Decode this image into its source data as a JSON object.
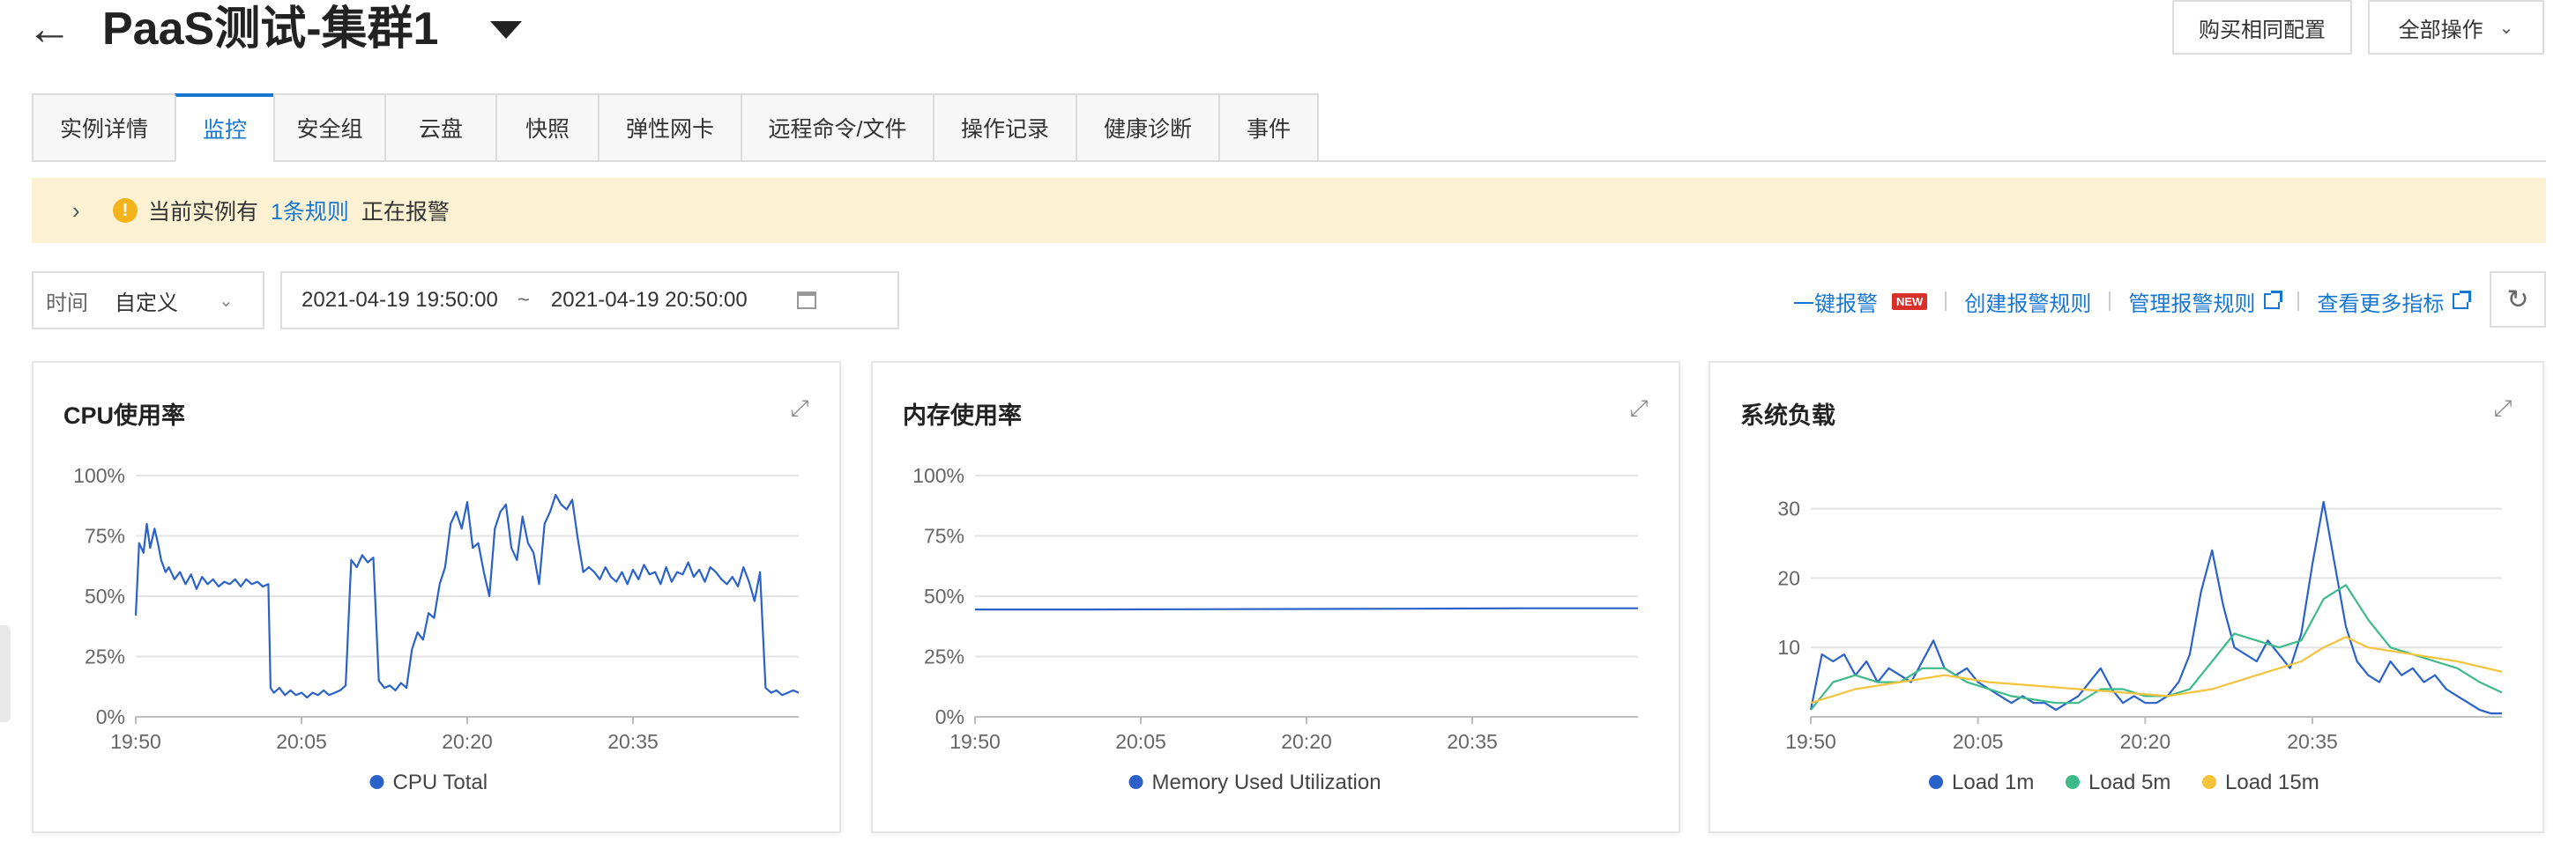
{
  "header": {
    "title": "PaaS测试-集群1",
    "buy_same_config": "购买相同配置",
    "all_operations": "全部操作"
  },
  "tabs": [
    {
      "label": "实例详情",
      "active": false
    },
    {
      "label": "监控",
      "active": true
    },
    {
      "label": "安全组",
      "active": false
    },
    {
      "label": "云盘",
      "active": false
    },
    {
      "label": "快照",
      "active": false
    },
    {
      "label": "弹性网卡",
      "active": false
    },
    {
      "label": "远程命令/文件",
      "active": false
    },
    {
      "label": "操作记录",
      "active": false
    },
    {
      "label": "健康诊断",
      "active": false
    },
    {
      "label": "事件",
      "active": false
    }
  ],
  "alert": {
    "prefix": "当前实例有",
    "link": "1条规则",
    "suffix": "正在报警"
  },
  "filter": {
    "time_label": "时间",
    "time_mode": "自定义",
    "start": "2021-04-19 19:50:00",
    "separator": "~",
    "end": "2021-04-19 20:50:00"
  },
  "actions": {
    "one_click_alarm": "一键报警",
    "new_badge": "NEW",
    "create_rule": "创建报警规则",
    "manage_rules": "管理报警规则",
    "more_metrics": "查看更多指标"
  },
  "colors": {
    "accent": "#1677d2",
    "load1": "#2a62c9",
    "load5": "#3dba8a",
    "load15": "#f4c23b",
    "alert_bg": "#fcf2d3"
  },
  "cards": [
    {
      "title": "CPU使用率",
      "chart_data": {
        "type": "line",
        "x_ticks": [
          "19:50",
          "20:05",
          "20:20",
          "20:35"
        ],
        "y_ticks": [
          "0%",
          "25%",
          "50%",
          "75%",
          "100%"
        ],
        "ylim": [
          0,
          100
        ],
        "xlim": [
          0,
          60
        ],
        "series": [
          {
            "name": "CPU Total",
            "color": "#2a62c9",
            "x": [
              0,
              0.3,
              0.7,
              1,
              1.3,
              1.7,
              2,
              2.3,
              2.7,
              3,
              3.5,
              4,
              4.5,
              5,
              5.5,
              6,
              6.5,
              7,
              7.5,
              8,
              8.5,
              9,
              9.5,
              10,
              10.5,
              11,
              11.5,
              12,
              12.2,
              12.5,
              13,
              13.5,
              14,
              14.5,
              15,
              15.5,
              16,
              16.5,
              17,
              17.5,
              18,
              18.5,
              19,
              19.5,
              20,
              20.5,
              21,
              21.5,
              22,
              22.5,
              23,
              23.5,
              24,
              24.5,
              25,
              25.5,
              26,
              26.5,
              27,
              27.5,
              28,
              28.5,
              29,
              29.5,
              30,
              30.5,
              31,
              31.5,
              32,
              32.5,
              33,
              33.5,
              34,
              34.5,
              35,
              35.5,
              36,
              36.5,
              37,
              37.5,
              38,
              38.5,
              39,
              39.5,
              40,
              40.5,
              41,
              41.5,
              42,
              42.5,
              43,
              43.5,
              44,
              44.5,
              45,
              45.5,
              46,
              46.5,
              47,
              47.5,
              48,
              48.5,
              49,
              49.5,
              50,
              50.5,
              51,
              51.5,
              52,
              52.5,
              53,
              53.5,
              54,
              54.5,
              55,
              55.5,
              56,
              56.5,
              57,
              57.5,
              58,
              58.5,
              59,
              59.5,
              60
            ],
            "values": [
              42,
              72,
              68,
              80,
              70,
              78,
              72,
              65,
              60,
              62,
              57,
              60,
              55,
              59,
              53,
              58,
              55,
              57,
              54,
              56,
              55,
              57,
              54,
              57,
              55,
              56,
              54,
              55,
              12,
              10,
              12,
              9,
              11,
              9,
              10,
              8,
              10,
              9,
              11,
              9,
              10,
              11,
              13,
              65,
              62,
              67,
              64,
              66,
              15,
              12,
              13,
              11,
              14,
              12,
              28,
              35,
              32,
              43,
              41,
              55,
              62,
              80,
              85,
              78,
              89,
              70,
              72,
              60,
              50,
              78,
              85,
              88,
              70,
              65,
              83,
              72,
              68,
              55,
              80,
              85,
              92,
              88,
              86,
              90,
              74,
              60,
              62,
              60,
              57,
              62,
              58,
              56,
              60,
              55,
              61,
              57,
              63,
              59,
              60,
              55,
              62,
              56,
              60,
              59,
              64,
              58,
              61,
              56,
              62,
              60,
              57,
              55,
              58,
              54,
              62,
              56,
              48,
              60,
              12,
              10,
              11,
              9,
              10,
              11,
              10,
              11,
              12,
              10,
              11
            ],
            "x_unit": "minutes since 19:50"
          }
        ]
      }
    },
    {
      "title": "内存使用率",
      "chart_data": {
        "type": "line",
        "x_ticks": [
          "19:50",
          "20:05",
          "20:20",
          "20:35"
        ],
        "y_ticks": [
          "0%",
          "25%",
          "50%",
          "75%",
          "100%"
        ],
        "ylim": [
          0,
          100
        ],
        "xlim": [
          0,
          60
        ],
        "series": [
          {
            "name": "Memory Used Utilization",
            "color": "#2a62c9",
            "x": [
              0,
              10,
              20,
              30,
              40,
              50,
              60
            ],
            "values": [
              44.5,
              44.5,
              44.6,
              44.7,
              44.8,
              45,
              45
            ]
          }
        ]
      }
    },
    {
      "title": "系统负载",
      "chart_data": {
        "type": "line",
        "x_ticks": [
          "19:50",
          "20:05",
          "20:20",
          "20:35"
        ],
        "y_ticks": [
          "10",
          "20",
          "30"
        ],
        "ylim": [
          0,
          33
        ],
        "xlim": [
          0,
          62
        ],
        "series": [
          {
            "name": "Load 1m",
            "color": "#2a62c9",
            "x": [
              0,
              1,
              2,
              3,
              4,
              5,
              6,
              7,
              8,
              9,
              10,
              11,
              12,
              13,
              14,
              15,
              16,
              17,
              18,
              19,
              20,
              21,
              22,
              23,
              24,
              25,
              26,
              27,
              28,
              29,
              30,
              31,
              32,
              33,
              34,
              35,
              36,
              37,
              38,
              39,
              40,
              41,
              42,
              43,
              44,
              45,
              46,
              47,
              48,
              49,
              50,
              51,
              52,
              53,
              54,
              55,
              56,
              57,
              58,
              59,
              60,
              61,
              62
            ],
            "values": [
              1,
              9,
              8,
              9,
              6,
              8,
              5,
              7,
              6,
              5,
              8,
              11,
              7,
              6,
              7,
              5,
              4,
              3,
              2,
              3,
              2,
              2,
              1,
              2,
              3,
              5,
              7,
              4,
              2,
              3,
              2,
              2,
              3,
              5,
              9,
              18,
              24,
              16,
              10,
              9,
              8,
              11,
              9,
              7,
              12,
              22,
              31,
              22,
              13,
              8,
              6,
              5,
              8,
              6,
              7,
              5,
              6,
              4,
              3,
              2,
              1,
              0.5,
              0.5
            ]
          },
          {
            "name": "Load 5m",
            "color": "#3dba8a",
            "x": [
              0,
              2,
              4,
              6,
              8,
              10,
              12,
              14,
              16,
              18,
              20,
              22,
              24,
              26,
              28,
              30,
              32,
              34,
              36,
              38,
              40,
              42,
              44,
              46,
              48,
              50,
              52,
              54,
              56,
              58,
              60,
              62
            ],
            "values": [
              1,
              5,
              6,
              5,
              5,
              7,
              7,
              5,
              4,
              3,
              2.5,
              2,
              2,
              4,
              4,
              3,
              3,
              4,
              8,
              12,
              11,
              10,
              11,
              17,
              19,
              14,
              10,
              9,
              8,
              7,
              5,
              3.5
            ]
          },
          {
            "name": "Load 15m",
            "color": "#f4c23b",
            "x": [
              0,
              4,
              8,
              12,
              16,
              20,
              24,
              28,
              32,
              36,
              40,
              44,
              46,
              48,
              50,
              54,
              58,
              62
            ],
            "values": [
              2,
              4,
              5,
              6,
              5,
              4.5,
              4,
              3.5,
              3,
              4,
              6,
              8,
              10,
              11.5,
              10,
              9,
              8,
              6.5
            ]
          }
        ]
      }
    }
  ]
}
